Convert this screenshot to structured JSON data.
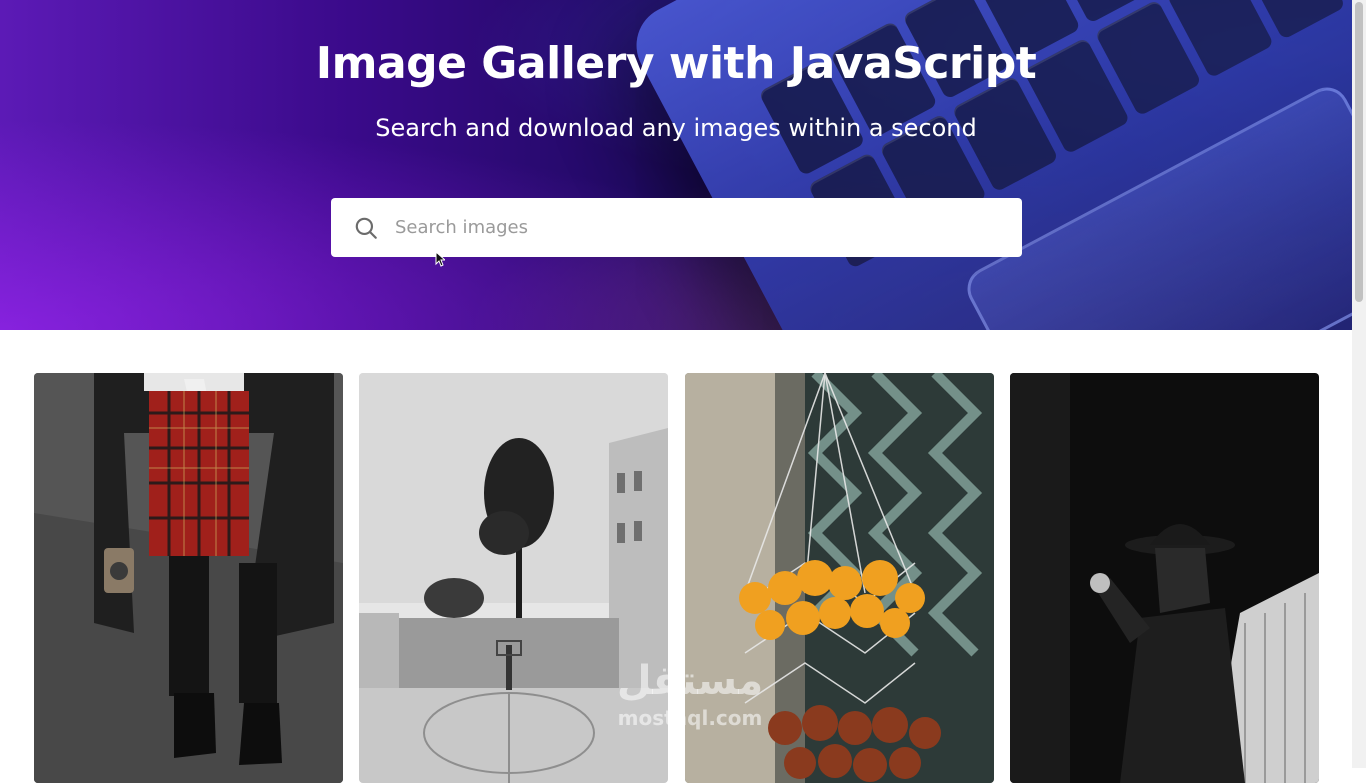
{
  "hero": {
    "title": "Image Gallery with JavaScript",
    "subtitle": "Search and download any images within a second"
  },
  "search": {
    "placeholder": "Search images",
    "value": "",
    "icon": "search-icon"
  },
  "gallery": {
    "images": [
      {
        "name": "plaid-skirt-coat-photo"
      },
      {
        "name": "courtyard-tree-basketball-court-photo"
      },
      {
        "name": "oranges-in-net-bag-photo"
      },
      {
        "name": "woman-in-hat-shadow-photo"
      }
    ]
  },
  "watermark": {
    "arabic": "مستقل",
    "latin": "mostaql.com"
  },
  "colors": {
    "hero_left": "#5c1ab6",
    "hero_right": "#1b2a8a",
    "search_bg": "#ffffff",
    "placeholder": "#9a9a9a"
  }
}
